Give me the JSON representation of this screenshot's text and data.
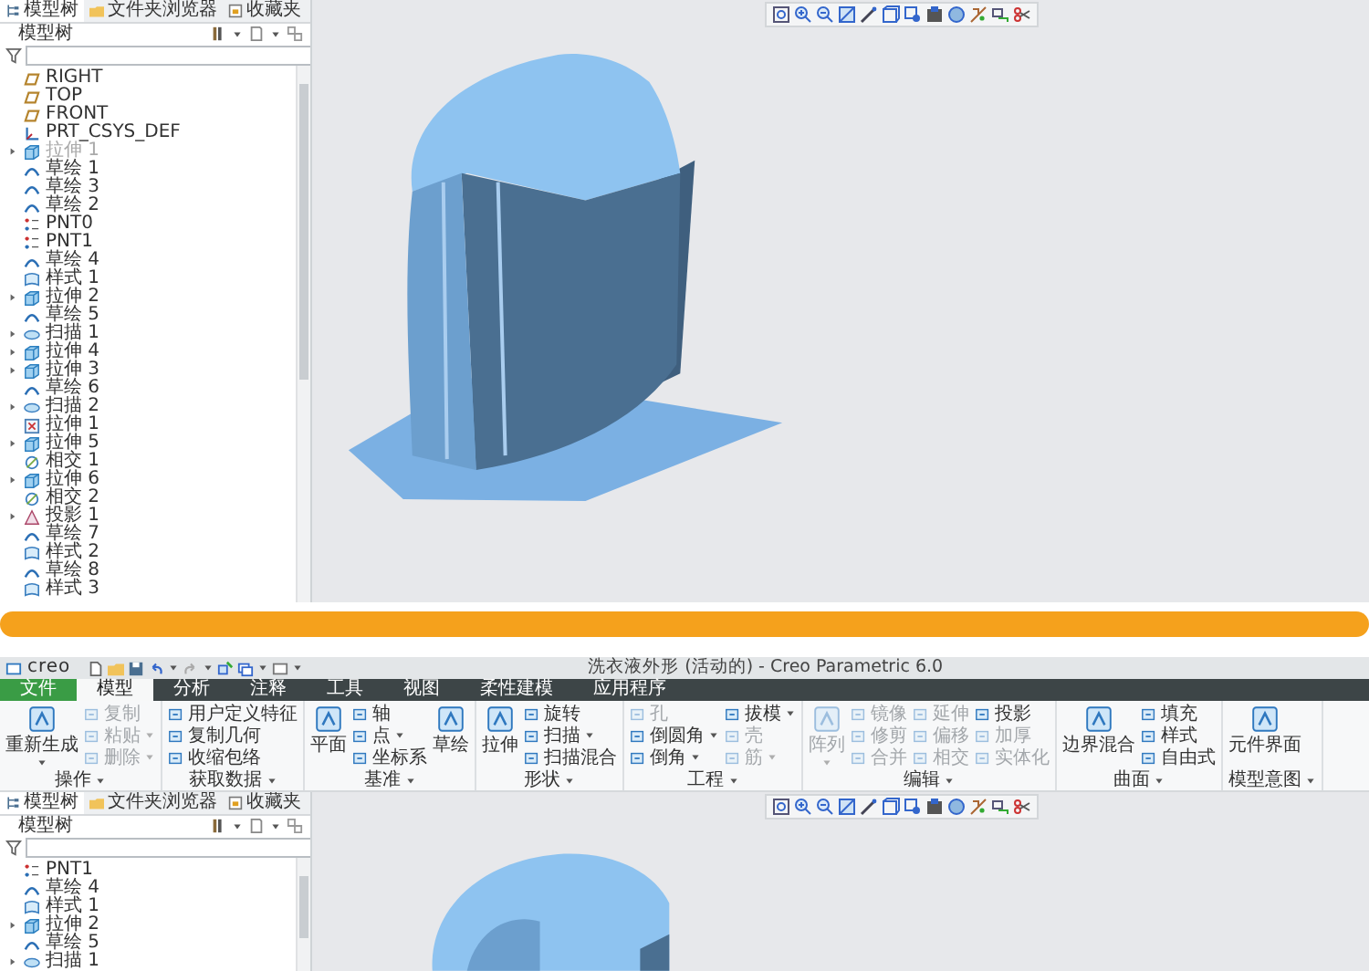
{
  "top_panel": {
    "tree_tabs": [
      {
        "label": "模型树",
        "selected": true
      },
      {
        "label": "文件夹浏览器",
        "selected": false
      },
      {
        "label": "收藏夹",
        "selected": false
      }
    ],
    "tree_header": "模型树",
    "tree_items": [
      {
        "label": "RIGHT",
        "kind": "plane",
        "expandable": false,
        "disabled": false
      },
      {
        "label": "TOP",
        "kind": "plane",
        "expandable": false,
        "disabled": false
      },
      {
        "label": "FRONT",
        "kind": "plane",
        "expandable": false,
        "disabled": false
      },
      {
        "label": "PRT_CSYS_DEF",
        "kind": "csys",
        "expandable": false,
        "disabled": false
      },
      {
        "label": "拉伸 1",
        "kind": "extrude",
        "expandable": true,
        "disabled": true
      },
      {
        "label": "草绘 1",
        "kind": "sketch",
        "expandable": false,
        "disabled": false
      },
      {
        "label": "草绘 3",
        "kind": "sketch",
        "expandable": false,
        "disabled": false
      },
      {
        "label": "草绘 2",
        "kind": "sketch",
        "expandable": false,
        "disabled": false
      },
      {
        "label": "PNT0",
        "kind": "point",
        "expandable": false,
        "disabled": false
      },
      {
        "label": "PNT1",
        "kind": "point",
        "expandable": false,
        "disabled": false
      },
      {
        "label": "草绘 4",
        "kind": "sketch",
        "expandable": false,
        "disabled": false
      },
      {
        "label": "样式 1",
        "kind": "style",
        "expandable": false,
        "disabled": false
      },
      {
        "label": "拉伸 2",
        "kind": "extrude",
        "expandable": true,
        "disabled": false
      },
      {
        "label": "草绘 5",
        "kind": "sketch",
        "expandable": false,
        "disabled": false
      },
      {
        "label": "扫描 1",
        "kind": "sweep",
        "expandable": true,
        "disabled": false
      },
      {
        "label": "拉伸 4",
        "kind": "extrude",
        "expandable": true,
        "disabled": false
      },
      {
        "label": "拉伸 3",
        "kind": "extrude",
        "expandable": true,
        "disabled": false
      },
      {
        "label": "草绘 6",
        "kind": "sketch",
        "expandable": false,
        "disabled": false
      },
      {
        "label": "扫描 2",
        "kind": "sweep",
        "expandable": true,
        "disabled": false
      },
      {
        "label": "拉伸 1",
        "kind": "cut",
        "expandable": false,
        "disabled": false
      },
      {
        "label": "拉伸 5",
        "kind": "extrude",
        "expandable": true,
        "disabled": false
      },
      {
        "label": "相交 1",
        "kind": "intersect",
        "expandable": false,
        "disabled": false
      },
      {
        "label": "拉伸 6",
        "kind": "extrude",
        "expandable": true,
        "disabled": false
      },
      {
        "label": "相交 2",
        "kind": "intersect",
        "expandable": false,
        "disabled": false
      },
      {
        "label": "投影 1",
        "kind": "projection",
        "expandable": true,
        "disabled": false
      },
      {
        "label": "草绘 7",
        "kind": "sketch",
        "expandable": false,
        "disabled": false
      },
      {
        "label": "样式 2",
        "kind": "style",
        "expandable": false,
        "disabled": false
      },
      {
        "label": "草绘 8",
        "kind": "sketch",
        "expandable": false,
        "disabled": false
      },
      {
        "label": "样式 3",
        "kind": "style",
        "expandable": false,
        "disabled": false
      }
    ]
  },
  "bottom_panel": {
    "logo": "creo",
    "window_title": "洗衣液外形 (活动的) - Creo Parametric 6.0",
    "ribbon_tabs": [
      {
        "label": "文件",
        "kind": "file",
        "selected": false
      },
      {
        "label": "模型",
        "kind": "tab",
        "selected": true
      },
      {
        "label": "分析",
        "kind": "tab",
        "selected": false
      },
      {
        "label": "注释",
        "kind": "tab",
        "selected": false
      },
      {
        "label": "工具",
        "kind": "tab",
        "selected": false
      },
      {
        "label": "视图",
        "kind": "tab",
        "selected": false
      },
      {
        "label": "柔性建模",
        "kind": "tab",
        "selected": false
      },
      {
        "label": "应用程序",
        "kind": "tab",
        "selected": false
      }
    ],
    "ribbon_groups": [
      {
        "label": "操作",
        "columns": [
          [
            {
              "label": "重新生成",
              "kind": "large",
              "disabled": false,
              "menu": true
            }
          ],
          [
            {
              "label": "复制",
              "kind": "small",
              "disabled": true,
              "menu": false
            },
            {
              "label": "粘贴",
              "kind": "small",
              "disabled": true,
              "menu": true
            },
            {
              "label": "删除",
              "kind": "small",
              "disabled": true,
              "menu": true
            }
          ]
        ]
      },
      {
        "label": "获取数据",
        "columns": [
          [
            {
              "label": "用户定义特征",
              "kind": "small",
              "disabled": false,
              "menu": false
            },
            {
              "label": "复制几何",
              "kind": "small",
              "disabled": false,
              "menu": false
            },
            {
              "label": "收缩包络",
              "kind": "small",
              "disabled": false,
              "menu": false
            }
          ]
        ]
      },
      {
        "label": "基准",
        "columns": [
          [
            {
              "label": "平面",
              "kind": "large",
              "disabled": false,
              "menu": false
            }
          ],
          [
            {
              "label": "轴",
              "kind": "small",
              "disabled": false,
              "menu": false
            },
            {
              "label": "点",
              "kind": "small",
              "disabled": false,
              "menu": true
            },
            {
              "label": "坐标系",
              "kind": "small",
              "disabled": false,
              "menu": false
            }
          ],
          [
            {
              "label": "草绘",
              "kind": "large",
              "disabled": false,
              "menu": false
            }
          ]
        ]
      },
      {
        "label": "形状",
        "columns": [
          [
            {
              "label": "拉伸",
              "kind": "large",
              "disabled": false,
              "menu": false
            }
          ],
          [
            {
              "label": "旋转",
              "kind": "small",
              "disabled": false,
              "menu": false
            },
            {
              "label": "扫描",
              "kind": "small",
              "disabled": false,
              "menu": true
            },
            {
              "label": "扫描混合",
              "kind": "small",
              "disabled": false,
              "menu": false
            }
          ]
        ]
      },
      {
        "label": "工程",
        "columns": [
          [
            {
              "label": "孔",
              "kind": "small",
              "disabled": true,
              "menu": false
            },
            {
              "label": "倒圆角",
              "kind": "small",
              "disabled": false,
              "menu": true
            },
            {
              "label": "倒角",
              "kind": "small",
              "disabled": false,
              "menu": true
            }
          ],
          [
            {
              "label": "拔模",
              "kind": "small",
              "disabled": false,
              "menu": true
            },
            {
              "label": "壳",
              "kind": "small",
              "disabled": true,
              "menu": false
            },
            {
              "label": "筋",
              "kind": "small",
              "disabled": true,
              "menu": true
            }
          ]
        ]
      },
      {
        "label": "编辑",
        "columns": [
          [
            {
              "label": "阵列",
              "kind": "large",
              "disabled": true,
              "menu": true
            }
          ],
          [
            {
              "label": "镜像",
              "kind": "small",
              "disabled": true,
              "menu": false
            },
            {
              "label": "修剪",
              "kind": "small",
              "disabled": true,
              "menu": false
            },
            {
              "label": "合并",
              "kind": "small",
              "disabled": true,
              "menu": false
            }
          ],
          [
            {
              "label": "延伸",
              "kind": "small",
              "disabled": true,
              "menu": false
            },
            {
              "label": "偏移",
              "kind": "small",
              "disabled": true,
              "menu": false
            },
            {
              "label": "相交",
              "kind": "small",
              "disabled": true,
              "menu": false
            }
          ],
          [
            {
              "label": "投影",
              "kind": "small",
              "disabled": false,
              "menu": false
            },
            {
              "label": "加厚",
              "kind": "small",
              "disabled": true,
              "menu": false
            },
            {
              "label": "实体化",
              "kind": "small",
              "disabled": true,
              "menu": false
            }
          ]
        ]
      },
      {
        "label": "曲面",
        "columns": [
          [
            {
              "label": "边界混合",
              "kind": "large",
              "disabled": false,
              "menu": false
            }
          ],
          [
            {
              "label": "填充",
              "kind": "small",
              "disabled": false,
              "menu": false
            },
            {
              "label": "样式",
              "kind": "small",
              "disabled": false,
              "menu": false
            },
            {
              "label": "自由式",
              "kind": "small",
              "disabled": false,
              "menu": false
            }
          ]
        ]
      },
      {
        "label": "模型意图",
        "columns": [
          [
            {
              "label": "元件界面",
              "kind": "large",
              "disabled": false,
              "menu": false
            }
          ]
        ]
      }
    ],
    "tree_tabs": [
      {
        "label": "模型树",
        "selected": true
      },
      {
        "label": "文件夹浏览器",
        "selected": false
      },
      {
        "label": "收藏夹",
        "selected": false
      }
    ],
    "tree_header": "模型树",
    "tree_items": [
      {
        "label": "PNT1",
        "kind": "point",
        "expandable": false,
        "disabled": false
      },
      {
        "label": "草绘 4",
        "kind": "sketch",
        "expandable": false,
        "disabled": false
      },
      {
        "label": "样式 1",
        "kind": "style",
        "expandable": false,
        "disabled": false
      },
      {
        "label": "拉伸 2",
        "kind": "extrude",
        "expandable": true,
        "disabled": false
      },
      {
        "label": "草绘 5",
        "kind": "sketch",
        "expandable": false,
        "disabled": false
      },
      {
        "label": "扫描 1",
        "kind": "sweep",
        "expandable": true,
        "disabled": false
      }
    ]
  }
}
